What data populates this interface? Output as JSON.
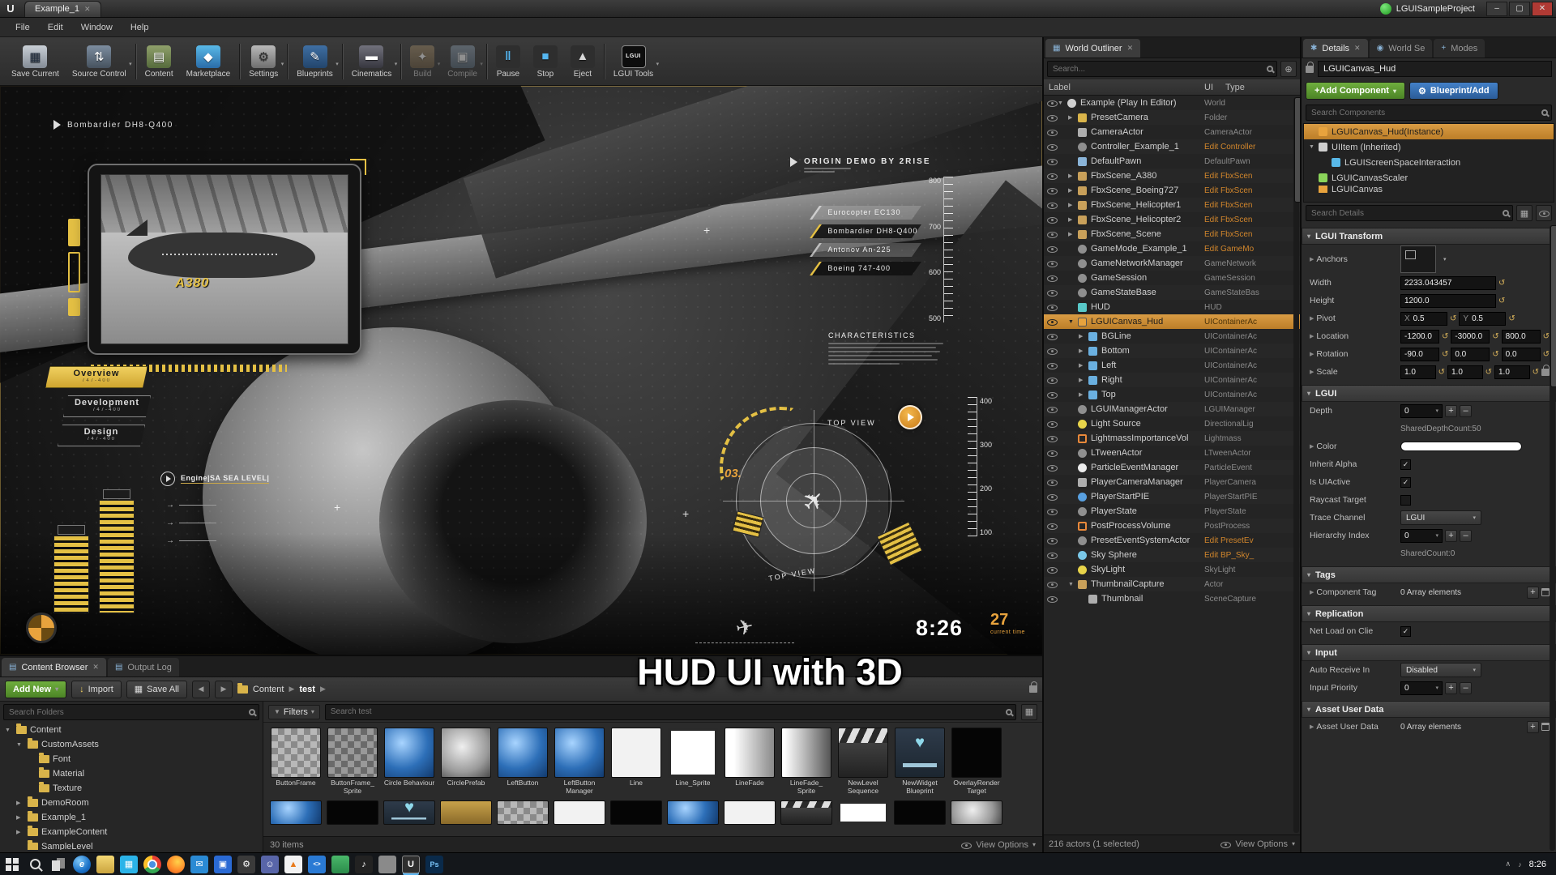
{
  "titlebar": {
    "tab": "Example_1",
    "project": "LGUISampleProject"
  },
  "menubar": {
    "items": [
      "File",
      "Edit",
      "Window",
      "Help"
    ]
  },
  "toolbar": {
    "groups": [
      {
        "buttons": [
          {
            "label": "Save Current",
            "icon": "save"
          },
          {
            "label": "Source Control",
            "icon": "source",
            "caret": true
          }
        ]
      },
      {
        "buttons": [
          {
            "label": "Content",
            "icon": "content"
          },
          {
            "label": "Marketplace",
            "icon": "marketplace"
          }
        ]
      },
      {
        "buttons": [
          {
            "label": "Settings",
            "icon": "settings",
            "caret": true
          }
        ]
      },
      {
        "buttons": [
          {
            "label": "Blueprints",
            "icon": "blueprints",
            "caret": true
          }
        ]
      },
      {
        "buttons": [
          {
            "label": "Cinematics",
            "icon": "cinematics",
            "caret": true
          }
        ]
      },
      {
        "buttons": [
          {
            "label": "Build",
            "icon": "build",
            "caret": true,
            "disabled": true
          },
          {
            "label": "Compile",
            "icon": "compile",
            "caret": true,
            "disabled": true
          }
        ]
      },
      {
        "buttons": [
          {
            "label": "Pause",
            "icon": "pause"
          },
          {
            "label": "Stop",
            "icon": "stop"
          },
          {
            "label": "Eject",
            "icon": "eject"
          }
        ]
      },
      {
        "buttons": [
          {
            "label": "LGUI Tools",
            "icon": "lgui",
            "caret": true
          }
        ]
      }
    ]
  },
  "viewport": {
    "top_label": "Bombardier  DH8-Q400",
    "phone_label": "A380",
    "origin_title": "ORIGIN DEMO BY 2RISE",
    "menu": [
      {
        "label": "Overview",
        "sub": "747-400",
        "active": true
      },
      {
        "label": "Development",
        "sub": "747-400",
        "active": false
      },
      {
        "label": "Design",
        "sub": "747-400",
        "active": false
      }
    ],
    "engine_label": "Engine|SA SEA LEVEL|",
    "tags": [
      {
        "label": "Eurocopter  EC130",
        "active": false
      },
      {
        "label": "Bombardier  DH8-Q400",
        "active": true
      },
      {
        "label": "Antonov  An-225",
        "active": false
      },
      {
        "label": "Boeing  747-400",
        "active": true
      }
    ],
    "ruler_top": [
      "800",
      "700",
      "600",
      "500"
    ],
    "ruler_bottom": [
      "400",
      "300",
      "200",
      "100"
    ],
    "characteristics_title": "CHARACTERISTICS",
    "top_view": "TOP VIEW",
    "index_number": "03.",
    "clock": "8:26",
    "counter": "27",
    "counter_sub": "current time",
    "caption": "HUD UI with 3D"
  },
  "outliner": {
    "tab": "World Outliner",
    "search_placeholder": "Search...",
    "columns": [
      "Label",
      "UI",
      "Type"
    ],
    "rows": [
      {
        "label": "Example (Play In Editor)",
        "type": "World",
        "indent": 0,
        "icon": "world",
        "expand": "open"
      },
      {
        "label": "PresetCamera",
        "type": "Folder",
        "indent": 1,
        "icon": "folder",
        "expand": "closed"
      },
      {
        "label": "CameraActor",
        "type": "CameraActor",
        "indent": 1,
        "icon": "camera"
      },
      {
        "label": "Controller_Example_1",
        "type": "Edit Controller",
        "indent": 1,
        "icon": "controller",
        "link": true
      },
      {
        "label": "DefaultPawn",
        "type": "DefaultPawn",
        "indent": 1,
        "icon": "pawn"
      },
      {
        "label": "FbxScene_A380",
        "type": "Edit FbxScen",
        "indent": 1,
        "icon": "cube",
        "expand": "closed",
        "link": true
      },
      {
        "label": "FbxScene_Boeing727",
        "type": "Edit FbxScen",
        "indent": 1,
        "icon": "cube",
        "expand": "closed",
        "link": true
      },
      {
        "label": "FbxScene_Helicopter1",
        "type": "Edit FbxScen",
        "indent": 1,
        "icon": "cube",
        "expand": "closed",
        "link": true
      },
      {
        "label": "FbxScene_Helicopter2",
        "type": "Edit FbxScen",
        "indent": 1,
        "icon": "cube",
        "expand": "closed",
        "link": true
      },
      {
        "label": "FbxScene_Scene",
        "type": "Edit FbxScen",
        "indent": 1,
        "icon": "cube",
        "expand": "closed",
        "link": true
      },
      {
        "label": "GameMode_Example_1",
        "type": "Edit GameMo",
        "indent": 1,
        "icon": "gear",
        "link": true
      },
      {
        "label": "GameNetworkManager",
        "type": "GameNetwork",
        "indent": 1,
        "icon": "gear"
      },
      {
        "label": "GameSession",
        "type": "GameSession",
        "indent": 1,
        "icon": "gear"
      },
      {
        "label": "GameStateBase",
        "type": "GameStateBas",
        "indent": 1,
        "icon": "gear"
      },
      {
        "label": "HUD",
        "type": "HUD",
        "indent": 1,
        "icon": "hud"
      },
      {
        "label": "LGUICanvas_Hud",
        "type": "UIContainerAc",
        "indent": 1,
        "icon": "canvas",
        "expand": "open",
        "selected": true
      },
      {
        "label": "BGLine",
        "type": "UIContainerAc",
        "indent": 2,
        "icon": "container",
        "expand": "closed"
      },
      {
        "label": "Bottom",
        "type": "UIContainerAc",
        "indent": 2,
        "icon": "container",
        "expand": "closed"
      },
      {
        "label": "Left",
        "type": "UIContainerAc",
        "indent": 2,
        "icon": "container",
        "expand": "closed"
      },
      {
        "label": "Right",
        "type": "UIContainerAc",
        "indent": 2,
        "icon": "container",
        "expand": "closed"
      },
      {
        "label": "Top",
        "type": "UIContainerAc",
        "indent": 2,
        "icon": "container",
        "expand": "closed"
      },
      {
        "label": "LGUIManagerActor",
        "type": "LGUIManager",
        "indent": 1,
        "icon": "gear"
      },
      {
        "label": "Light Source",
        "type": "DirectionalLig",
        "indent": 1,
        "icon": "light"
      },
      {
        "label": "LightmassImportanceVol",
        "type": "Lightmass",
        "indent": 1,
        "icon": "volume"
      },
      {
        "label": "LTweenActor",
        "type": "LTweenActor",
        "indent": 1,
        "icon": "gear"
      },
      {
        "label": "ParticleEventManager",
        "type": "ParticleEvent",
        "indent": 1,
        "icon": "particle"
      },
      {
        "label": "PlayerCameraManager",
        "type": "PlayerCamera",
        "indent": 1,
        "icon": "camera2"
      },
      {
        "label": "PlayerStartPIE",
        "type": "PlayerStartPIE",
        "indent": 1,
        "icon": "player"
      },
      {
        "label": "PlayerState",
        "type": "PlayerState",
        "indent": 1,
        "icon": "gear"
      },
      {
        "label": "PostProcessVolume",
        "type": "PostProcess",
        "indent": 1,
        "icon": "volume"
      },
      {
        "label": "PresetEventSystemActor",
        "type": "Edit PresetEv",
        "indent": 1,
        "icon": "gear",
        "link": true
      },
      {
        "label": "Sky Sphere",
        "type": "Edit BP_Sky_",
        "indent": 1,
        "icon": "sky",
        "link": true
      },
      {
        "label": "SkyLight",
        "type": "SkyLight",
        "indent": 1,
        "icon": "light"
      },
      {
        "label": "ThumbnailCapture",
        "type": "Actor",
        "indent": 1,
        "icon": "cube",
        "expand": "open"
      },
      {
        "label": "Thumbnail",
        "type": "SceneCapture",
        "indent": 2,
        "icon": "camera"
      }
    ],
    "footer": "216 actors (1 selected)",
    "view_options": "View Options"
  },
  "details": {
    "tabs": [
      {
        "label": "Details",
        "icon": "details",
        "active": true
      },
      {
        "label": "World Se",
        "icon": "world",
        "active": false
      },
      {
        "label": "Modes",
        "icon": "modes",
        "active": false
      }
    ],
    "name_field": "LGUICanvas_Hud",
    "add_component_label": "+Add Component",
    "blueprint_add_label": "Blueprint/Add",
    "search_components_placeholder": "Search Components",
    "components": [
      {
        "label": "LGUICanvas_Hud(Instance)",
        "icon": "canvas",
        "selected": true
      },
      {
        "label": "UIItem (Inherited)",
        "icon": "item",
        "expand": "open"
      },
      {
        "label": "LGUIScreenSpaceInteraction",
        "icon": "interaction",
        "indent": 1
      },
      {
        "label": "LGUICanvasScaler",
        "icon": "scaler"
      },
      {
        "label": "LGUICanvas",
        "icon": "canvas",
        "clipped": true
      }
    ],
    "search_details_placeholder": "Search Details",
    "sections": [
      {
        "title": "LGUI Transform",
        "rows": [
          {
            "label": "Anchors",
            "type": "anchor",
            "expander": true
          },
          {
            "label": "Width",
            "type": "num",
            "values": [
              "2233.043457"
            ]
          },
          {
            "label": "Height",
            "type": "num",
            "values": [
              "1200.0"
            ]
          },
          {
            "label": "Pivot",
            "type": "numxy",
            "prefixes": [
              "X",
              "Y"
            ],
            "values": [
              "0.5",
              "0.5"
            ],
            "expander": true
          },
          {
            "label": "Location",
            "type": "num3",
            "values": [
              "-1200.0",
              "-3000.0",
              "800.0"
            ],
            "expander": true
          },
          {
            "label": "Rotation",
            "type": "num3",
            "values": [
              "-90.0",
              "0.0",
              "0.0"
            ],
            "expander": true
          },
          {
            "label": "Scale",
            "type": "num3",
            "values": [
              "1.0",
              "1.0",
              "1.0"
            ],
            "expander": true,
            "lock": true
          }
        ]
      },
      {
        "title": "LGUI",
        "rows": [
          {
            "label": "Depth",
            "type": "stepper",
            "value": "0"
          },
          {
            "label": "",
            "type": "note",
            "value": "SharedDepthCount:50"
          },
          {
            "label": "Color",
            "type": "color",
            "value": "#ffffff",
            "expander": true
          },
          {
            "label": "Inherit Alpha",
            "type": "check",
            "checked": true
          },
          {
            "label": "Is UIActive",
            "type": "check",
            "checked": true
          },
          {
            "label": "Raycast Target",
            "type": "check",
            "checked": false
          },
          {
            "label": "Trace Channel",
            "type": "dropdown",
            "value": "LGUI"
          },
          {
            "label": "Hierarchy Index",
            "type": "stepper",
            "value": "0"
          },
          {
            "label": "",
            "type": "note",
            "value": "SharedCount:0"
          }
        ]
      },
      {
        "title": "Tags",
        "rows": [
          {
            "label": "Component Tag",
            "type": "array",
            "value": "0 Array elements",
            "expander": true
          }
        ]
      },
      {
        "title": "Replication",
        "rows": [
          {
            "label": "Net Load on Clie",
            "type": "check",
            "checked": true
          }
        ]
      },
      {
        "title": "Input",
        "rows": [
          {
            "label": "Auto Receive In",
            "type": "dropdown",
            "value": "Disabled"
          },
          {
            "label": "Input Priority",
            "type": "stepper",
            "value": "0"
          }
        ]
      },
      {
        "title": "Asset User Data",
        "rows": [
          {
            "label": "Asset User Data",
            "type": "array",
            "value": "0 Array elements",
            "expander": true
          }
        ]
      }
    ]
  },
  "content_browser": {
    "tabs": [
      {
        "label": "Content Browser",
        "active": true
      },
      {
        "label": "Output Log",
        "active": false
      }
    ],
    "add_new_label": "Add New",
    "import_label": "Import",
    "save_all_label": "Save All",
    "breadcrumb": [
      "Content",
      "test"
    ],
    "search_folders_placeholder": "Search Folders",
    "folders": [
      {
        "label": "Content",
        "indent": 0,
        "expand": "open"
      },
      {
        "label": "CustomAssets",
        "indent": 1,
        "expand": "open"
      },
      {
        "label": "Font",
        "indent": 2
      },
      {
        "label": "Material",
        "indent": 2
      },
      {
        "label": "Texture",
        "indent": 2
      },
      {
        "label": "DemoRoom",
        "indent": 1,
        "expand": "closed"
      },
      {
        "label": "Example_1",
        "indent": 1,
        "expand": "closed"
      },
      {
        "label": "ExampleContent",
        "indent": 1,
        "expand": "closed"
      },
      {
        "label": "SampleLevel",
        "indent": 1
      }
    ],
    "filters_label": "Filters",
    "search_assets_placeholder": "Search test",
    "assets": [
      {
        "name": "ButtonFrame",
        "thumb": "checker"
      },
      {
        "name": "ButtonFrame_ Sprite",
        "thumb": "checker2"
      },
      {
        "name": "Circle Behaviour",
        "thumb": "sphere"
      },
      {
        "name": "CirclePrefab",
        "thumb": "circle"
      },
      {
        "name": "LeftButton",
        "thumb": "sphere"
      },
      {
        "name": "LeftButton Manager",
        "thumb": "sphere"
      },
      {
        "name": "Line",
        "thumb": "white"
      },
      {
        "name": "Line_Sprite",
        "thumb": "white2"
      },
      {
        "name": "LineFade",
        "thumb": "fade"
      },
      {
        "name": "LineFade_ Sprite",
        "thumb": "fade2"
      },
      {
        "name": "NewLevel Sequence",
        "thumb": "clapper"
      },
      {
        "name": "NewWidget Blueprint",
        "thumb": "widget"
      },
      {
        "name": "OverlayRender Target",
        "thumb": "black"
      }
    ],
    "partial_row": [
      "sphere",
      "black",
      "widget",
      "gold",
      "checker",
      "white",
      "black",
      "sphere",
      "white",
      "clapper",
      "white2",
      "black",
      "circle"
    ],
    "items_count": "30 items",
    "view_options": "View Options"
  },
  "taskbar": {
    "icons": [
      "start",
      "search",
      "task-view",
      "edge",
      "explorer",
      "store",
      "chrome",
      "firefox",
      "mail",
      "photos",
      "settings",
      "discord",
      "vlc",
      "code",
      "green",
      "sound",
      "image",
      "unreal",
      "ps"
    ],
    "time": "8:26"
  }
}
